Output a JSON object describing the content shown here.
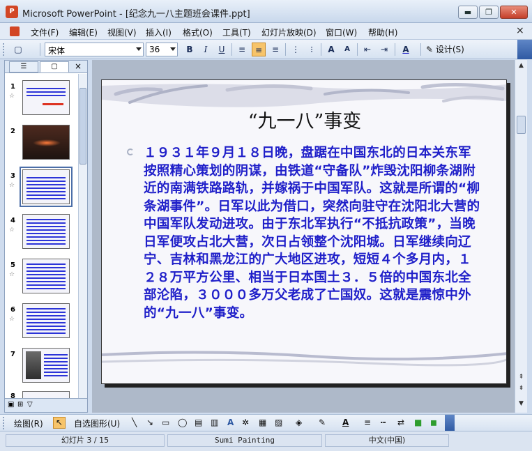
{
  "window": {
    "app_icon_text": "P",
    "title": "Microsoft PowerPoint - [纪念九一八主题班会课件.ppt]",
    "min_label": "▬",
    "max_label": "❐",
    "close_label": "✕"
  },
  "menubar": {
    "items": [
      "文件(F)",
      "编辑(E)",
      "视图(V)",
      "插入(I)",
      "格式(O)",
      "工具(T)",
      "幻灯片放映(D)",
      "窗口(W)",
      "帮助(H)"
    ],
    "close_label": "×"
  },
  "toolbar": {
    "font_name": "宋体",
    "font_size": "36",
    "bold": "B",
    "italic": "I",
    "underline": "U",
    "increase_font": "A",
    "decrease_font": "A",
    "font_color": "A",
    "design_label": "设计(S)"
  },
  "left_pane": {
    "tab_outline": "☰",
    "tab_slides": "▢",
    "close_label": "×",
    "slides": [
      {
        "num": "1",
        "star": "☆"
      },
      {
        "num": "2",
        "star": ""
      },
      {
        "num": "3",
        "star": "☆"
      },
      {
        "num": "4",
        "star": "☆"
      },
      {
        "num": "5",
        "star": "☆"
      },
      {
        "num": "6",
        "star": "☆"
      },
      {
        "num": "7",
        "star": ""
      },
      {
        "num": "8",
        "star": ""
      }
    ]
  },
  "slide": {
    "title": "“九一八”事变",
    "body": "１９３１年９月１８日晚，盘踞在中国东北的日本关东军按照精心策划的阴谋，由铁道“守备队”炸毁沈阳柳条湖附近的南满铁路路轨，并嫁祸于中国军队。这就是所谓的“柳条湖事件”。日军以此为借口，突然向驻守在沈阳北大营的中国军队发动进攻。由于东北军执行“不抵抗政策”，当晚日军便攻占北大营，次日占领整个沈阳城。日军继续向辽宁、吉林和黑龙江的广大地区进攻，短短４个多月内，１２８万平方公里、相当于日本国土３．５倍的中国东北全部沦陷，３０００多万父老成了亡国奴。这就是震惊中外的“九一八”事变。"
  },
  "drawbar": {
    "draw_label": "绘图(R)",
    "autoshape_label": "自选图形(U)"
  },
  "status": {
    "slide_counter": "幻灯片 3 / 15",
    "design_name": "Sumi Painting",
    "language": "中文(中国)"
  }
}
